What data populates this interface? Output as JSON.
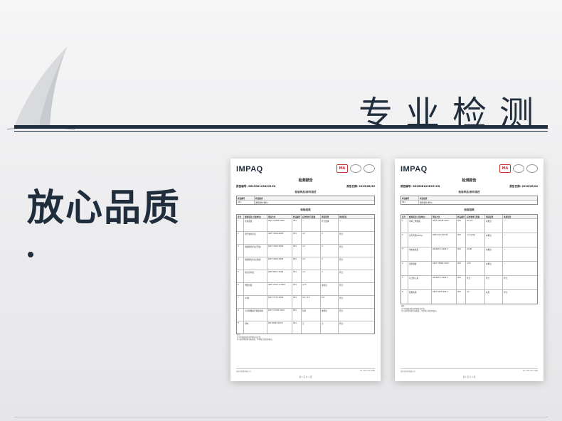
{
  "header": {
    "title": "专业检测"
  },
  "slogan": "放心品质",
  "reports": [
    {
      "brand": "IMPAQ",
      "mark_ma": "MA",
      "doc_title": "检测报告",
      "report_no": "报告编号: SZ25081236291CN",
      "report_date": "报告日期: 2025/08/30",
      "sample_section": "检验样品/部件描述",
      "sample_headers": [
        "样品编号",
        "样品描述"
      ],
      "sample_row": [
        "001",
        "透明胶件(塑料)"
      ],
      "result_section": "检验结果",
      "result_headers": [
        "序号",
        "检验项目(计量单位)",
        "测试方法",
        "样品编号",
        "标准要求与限量",
        "测试结果",
        "单项结论"
      ],
      "rows": [
        [
          "1",
          "外观质量",
          "GB/T 10000-2020",
          "001",
          "—",
          "符合要求",
          "—"
        ],
        [
          "2",
          "耐干磨色牢度",
          "GB/T 3920-2008",
          "001",
          "≥3",
          "4",
          "符合"
        ],
        [
          "3",
          "耐摩擦色牢度(干摩)",
          "GB/T 3920-2008",
          "001",
          "≥3",
          "4",
          "符合"
        ],
        [
          "4",
          "耐摩擦色牢度(湿摩)",
          "GB/T 3920-2008",
          "001",
          "≥3",
          "4",
          "符合"
        ],
        [
          "5",
          "耐光色牢度",
          "GB/T 8427-2019",
          "001",
          "≥4",
          "4",
          "符合"
        ],
        [
          "6",
          "甲醛含量",
          "GB/T 2912.1-2009",
          "001",
          "≤75",
          "未检出",
          "符合"
        ],
        [
          "7",
          "pH值",
          "GB/T 7573-2009",
          "001",
          "4.0~8.5",
          "6.8",
          "符合"
        ],
        [
          "8",
          "可分解致癌芳香胺染料",
          "GB/T 17592-2024",
          "001",
          "禁用",
          "未检出",
          "符合"
        ],
        [
          "9",
          "异味",
          "GB 18401-2010",
          "001",
          "无",
          "无",
          "符合"
        ]
      ],
      "notes": [
        "备注:",
        "[1] 检测结果仅对所检样品负责。",
        "[2] 未经本机构书面批准，不得部分复制本报告。"
      ],
      "footer_left": "深圳市检测有限公司",
      "footer_right": "Tel: 400-700-2288",
      "page": "第 1 页 共 1 页"
    },
    {
      "brand": "IMPAQ",
      "mark_ma": "MA",
      "doc_title": "检测报告",
      "report_no": "报告编号: SZ25081236291CN",
      "report_date": "报告日期: 2025/08/04",
      "sample_section": "检验样品/部件描述",
      "sample_headers": [
        "样品编号",
        "样品描述"
      ],
      "sample_row": [
        "001",
        "透明胶件(塑料)"
      ],
      "result_section": "检验结果",
      "result_headers": [
        "序号",
        "检验项目(计量单位)",
        "测试方法",
        "样品编号",
        "标准要求与限量",
        "测试结果",
        "单项结论"
      ],
      "rows": [
        [
          "1",
          "邻苯二甲酸酯",
          "GB/T 22048-2022",
          "001",
          "≤0.1%",
          "未检出",
          "—"
        ],
        [
          "2",
          "多环芳烃(PAHs)",
          "AfPS GS 2019:01",
          "001",
          "≤1mg/kg",
          "未检出",
          "—"
        ],
        [
          "3",
          "重金属总量",
          "GB 6675.4-2014",
          "001",
          "≤100",
          "未检出",
          "—"
        ],
        [
          "4",
          "溶剂残留",
          "GB/T 37884-2019",
          "001",
          "≤30",
          "未检出",
          "—"
        ],
        [
          "5",
          "可迁移元素",
          "GB 6675.4-2014",
          "001",
          "符合",
          "符合",
          "符合"
        ],
        [
          "6",
          "阻燃性能",
          "GB/T 5455-2014",
          "001",
          "≤1",
          "未见",
          "符合"
        ]
      ],
      "notes": [
        "备注:",
        "[1] 检测结果仅对所检样品负责。",
        "[2] 未经本机构书面批准，不得部分复制本报告。"
      ],
      "footer_left": "深圳市检测有限公司",
      "footer_right": "Tel: 400-700-2288",
      "page": "第 1 页 共 1 页"
    }
  ],
  "colors": {
    "navy": "#1f2d3d",
    "accent_red": "#cc3333"
  }
}
